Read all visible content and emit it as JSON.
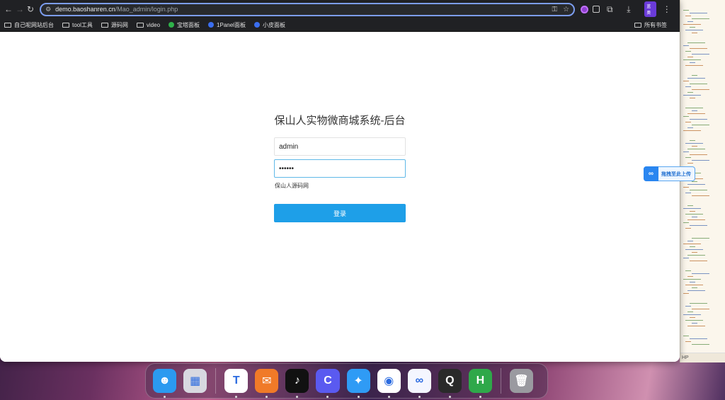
{
  "browser": {
    "url_host": "demo.baoshanren.cn",
    "url_path": "/Mao_admin/login.php",
    "profile_badge": "蓝奥"
  },
  "bookmarks": {
    "items": [
      {
        "label": "自己呢网站后台",
        "icon": "folder-icon"
      },
      {
        "label": "tool工具",
        "icon": "folder-icon"
      },
      {
        "label": "源码网",
        "icon": "folder-icon"
      },
      {
        "label": "video",
        "icon": "folder-icon"
      },
      {
        "label": "宝塔面板",
        "icon": "baota-icon",
        "color": "#2fb24a"
      },
      {
        "label": "1Panel面板",
        "icon": "1panel-icon",
        "color": "#3a6ef0"
      },
      {
        "label": "小皮面板",
        "icon": "xp-icon",
        "color": "#3a6ef0"
      }
    ],
    "all_bookmarks": "所有书签"
  },
  "login": {
    "title": "保山人实物微商城系统-后台",
    "username_value": "admin",
    "password_value": "••••••",
    "remember_text": "保山人源码网",
    "login_label": "登录"
  },
  "upload_widget": {
    "label": "拖拽至此上传"
  },
  "editor": {
    "status_text": "HP"
  },
  "dock": {
    "apps": [
      {
        "name": "finder-icon",
        "color": "#2b9af0",
        "glyph": "☻",
        "running": true
      },
      {
        "name": "launchpad-icon",
        "color": "#d8d8e0",
        "glyph": "▦",
        "running": false
      },
      {
        "name": "toDesk-icon",
        "color": "#ffffff",
        "glyph": "T",
        "running": true
      },
      {
        "name": "mailmaster-icon",
        "color": "#f07a28",
        "glyph": "✉",
        "running": true
      },
      {
        "name": "tiktok-icon",
        "color": "#111111",
        "glyph": "♪",
        "running": true
      },
      {
        "name": "quark-icon",
        "color": "#5a5af0",
        "glyph": "C",
        "running": true
      },
      {
        "name": "safari-icon",
        "color": "#2f9bf5",
        "glyph": "✦",
        "running": true
      },
      {
        "name": "chrome-icon",
        "color": "#ffffff",
        "glyph": "◉",
        "running": true
      },
      {
        "name": "baidunetdisk-icon",
        "color": "#f4f6ff",
        "glyph": "∞",
        "running": true
      },
      {
        "name": "quicktime-icon",
        "color": "#2a2a2a",
        "glyph": "Q",
        "running": true
      },
      {
        "name": "hbuilder-icon",
        "color": "#2fa84a",
        "glyph": "H",
        "running": true
      },
      {
        "name": "trash-icon",
        "color": "#9a9aa0",
        "glyph": "🗑",
        "running": false
      }
    ]
  }
}
